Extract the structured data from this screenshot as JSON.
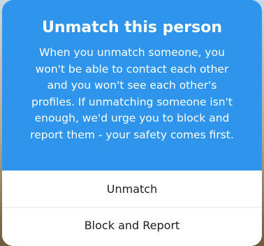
{
  "dialog": {
    "title": "Unmatch this person",
    "message": "When you unmatch someone, you\nwon't be able to contact each other\nand you won't see each other's\nprofiles. If unmatching someone isn't\nenough, we'd urge you to block and\nreport them - your safety comes first.",
    "accent_color": "#2f95ec",
    "actions": {
      "unmatch_label": "Unmatch",
      "block_report_label": "Block and Report"
    }
  }
}
